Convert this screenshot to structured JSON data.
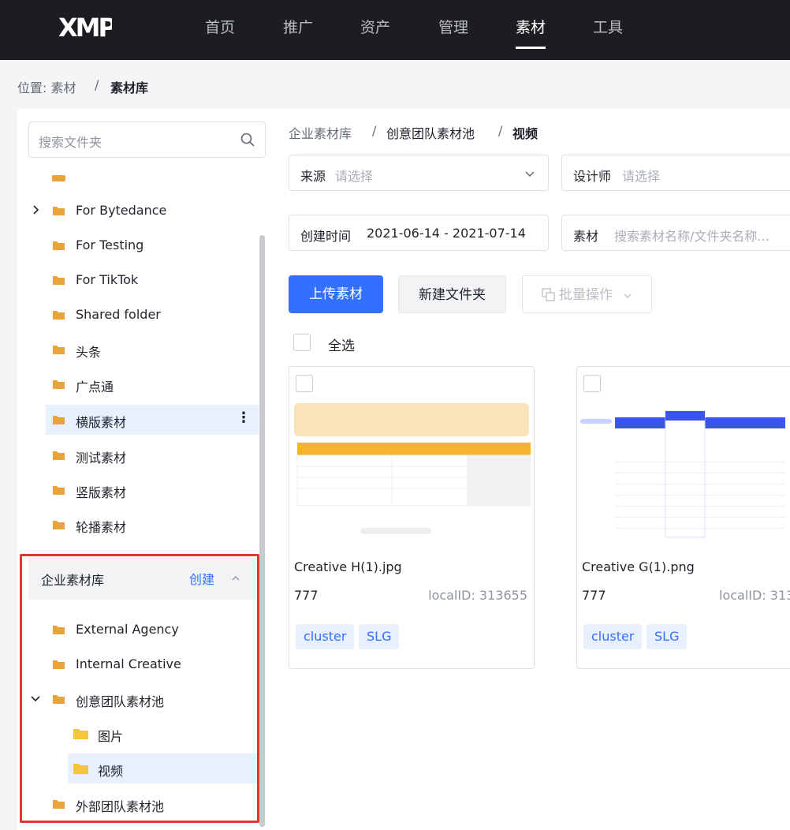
{
  "nav": {
    "logo": "XMP",
    "items": [
      "首页",
      "推广",
      "资产",
      "管理",
      "素材",
      "工具"
    ],
    "active": "素材"
  },
  "breadcrumb": {
    "prefix": "位置: 素材",
    "sep": "/",
    "current": "素材库"
  },
  "sidebar": {
    "search_placeholder": "搜索文件夹",
    "folders_top": [
      {
        "label": "For Bytedance",
        "expandable": true
      },
      {
        "label": "For Testing"
      },
      {
        "label": "For TikTok"
      },
      {
        "label": "Shared folder"
      },
      {
        "label": "头条"
      },
      {
        "label": "广点通"
      },
      {
        "label": "横版素材",
        "selected": true,
        "more": "⋮"
      },
      {
        "label": "测试素材"
      },
      {
        "label": "竖版素材"
      },
      {
        "label": "轮播素材"
      }
    ],
    "enterprise": {
      "title": "企业素材库",
      "create_label": "创建",
      "collapse_icon": "chevron-up-icon"
    },
    "folders_enterprise": [
      {
        "label": "External Agency"
      },
      {
        "label": "Internal Creative"
      },
      {
        "label": "创意团队素材池",
        "expanded": true
      },
      {
        "label": "图片",
        "child": true
      },
      {
        "label": "视频",
        "child": true,
        "selected": true
      },
      {
        "label": "外部团队素材池"
      }
    ]
  },
  "main": {
    "breadcrumb": [
      "企业素材库",
      "创意团队素材池",
      "视频"
    ],
    "filters": {
      "source_label": "来源",
      "source_placeholder": "请选择",
      "designer_label": "设计师",
      "designer_placeholder": "请选择",
      "created_label": "创建时间",
      "created_value": "2021-06-14 - 2021-07-14",
      "material_label": "素材",
      "material_placeholder": "搜索素材名称/文件夹名称..."
    },
    "actions": {
      "upload": "上传素材",
      "new_folder": "新建文件夹",
      "batch": "批量操作"
    },
    "select_all": "全选",
    "cards": [
      {
        "name": "Creative H(1).jpg",
        "count": "777",
        "local_id": "localID: 313655",
        "tags": [
          "cluster",
          "SLG"
        ]
      },
      {
        "name": "Creative G(1).png",
        "count": "777",
        "local_id": "localID: 313",
        "tags": [
          "cluster",
          "SLG"
        ]
      }
    ]
  },
  "colors": {
    "accent": "#3370ff",
    "nav_bg": "#1c1d20",
    "folder": "#e8a33a",
    "highlight_box": "#e0392b"
  }
}
